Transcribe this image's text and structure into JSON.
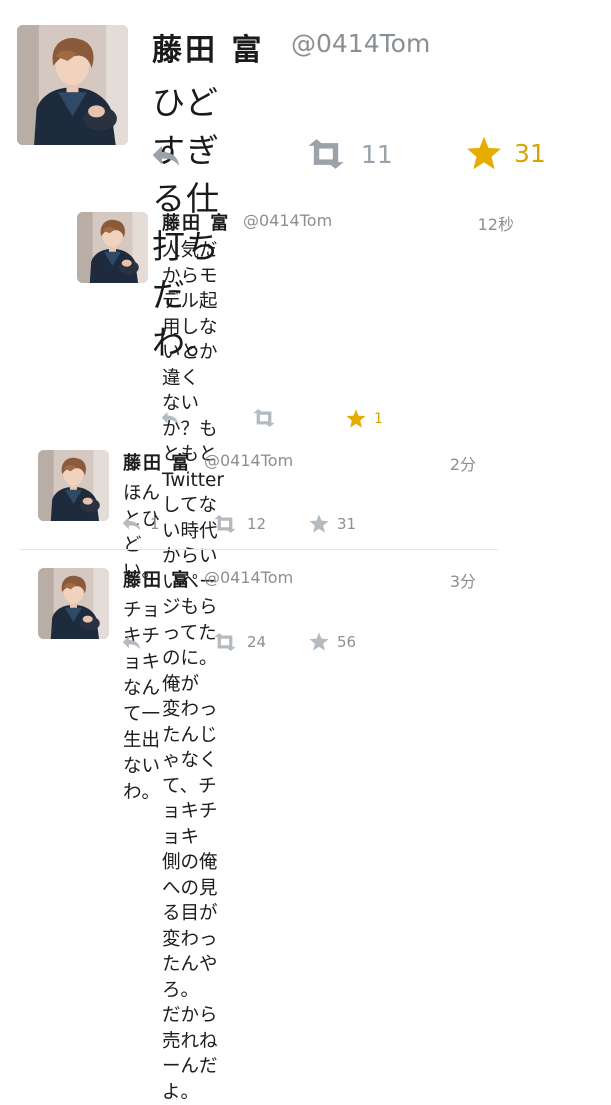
{
  "tweets": [
    {
      "name": "藤田 富",
      "handle": "@0414Tom",
      "time": "",
      "text": "ひどすぎる仕打ちだわ。",
      "retweets": "11",
      "favorites": "31",
      "favorited": true
    },
    {
      "name": "藤田 富",
      "handle": "@0414Tom",
      "time": "12秒",
      "text": "人気だからモデル起用しないとか違く\nないか？もともとTwitterしてない時代\nからいいページもらってたのに。俺が\n変わったんじゃなくて、チョキチョキ\n側の俺への見る目が変わったんやろ。\nだから売れねーんだよ。",
      "retweets": "",
      "favorites": "1",
      "favorited": true
    },
    {
      "name": "藤田 富",
      "handle": "@0414Tom",
      "time": "2分",
      "text": "ほんとひどい。",
      "replies": "1",
      "retweets": "12",
      "favorites": "31",
      "favorited": false
    },
    {
      "name": "藤田 富",
      "handle": "@0414Tom",
      "time": "3分",
      "text": "チョキチョキなんて一生出ないわ。",
      "replies": "",
      "retweets": "24",
      "favorites": "56",
      "favorited": false
    }
  ],
  "colors": {
    "gold": "#e6ac00",
    "gray_icon": "#9aa3ab",
    "text": "#1d1d1d",
    "secondary": "#8a8f94"
  },
  "icons": [
    "avatar-photo",
    "reply-icon",
    "retweet-icon",
    "star-icon"
  ]
}
